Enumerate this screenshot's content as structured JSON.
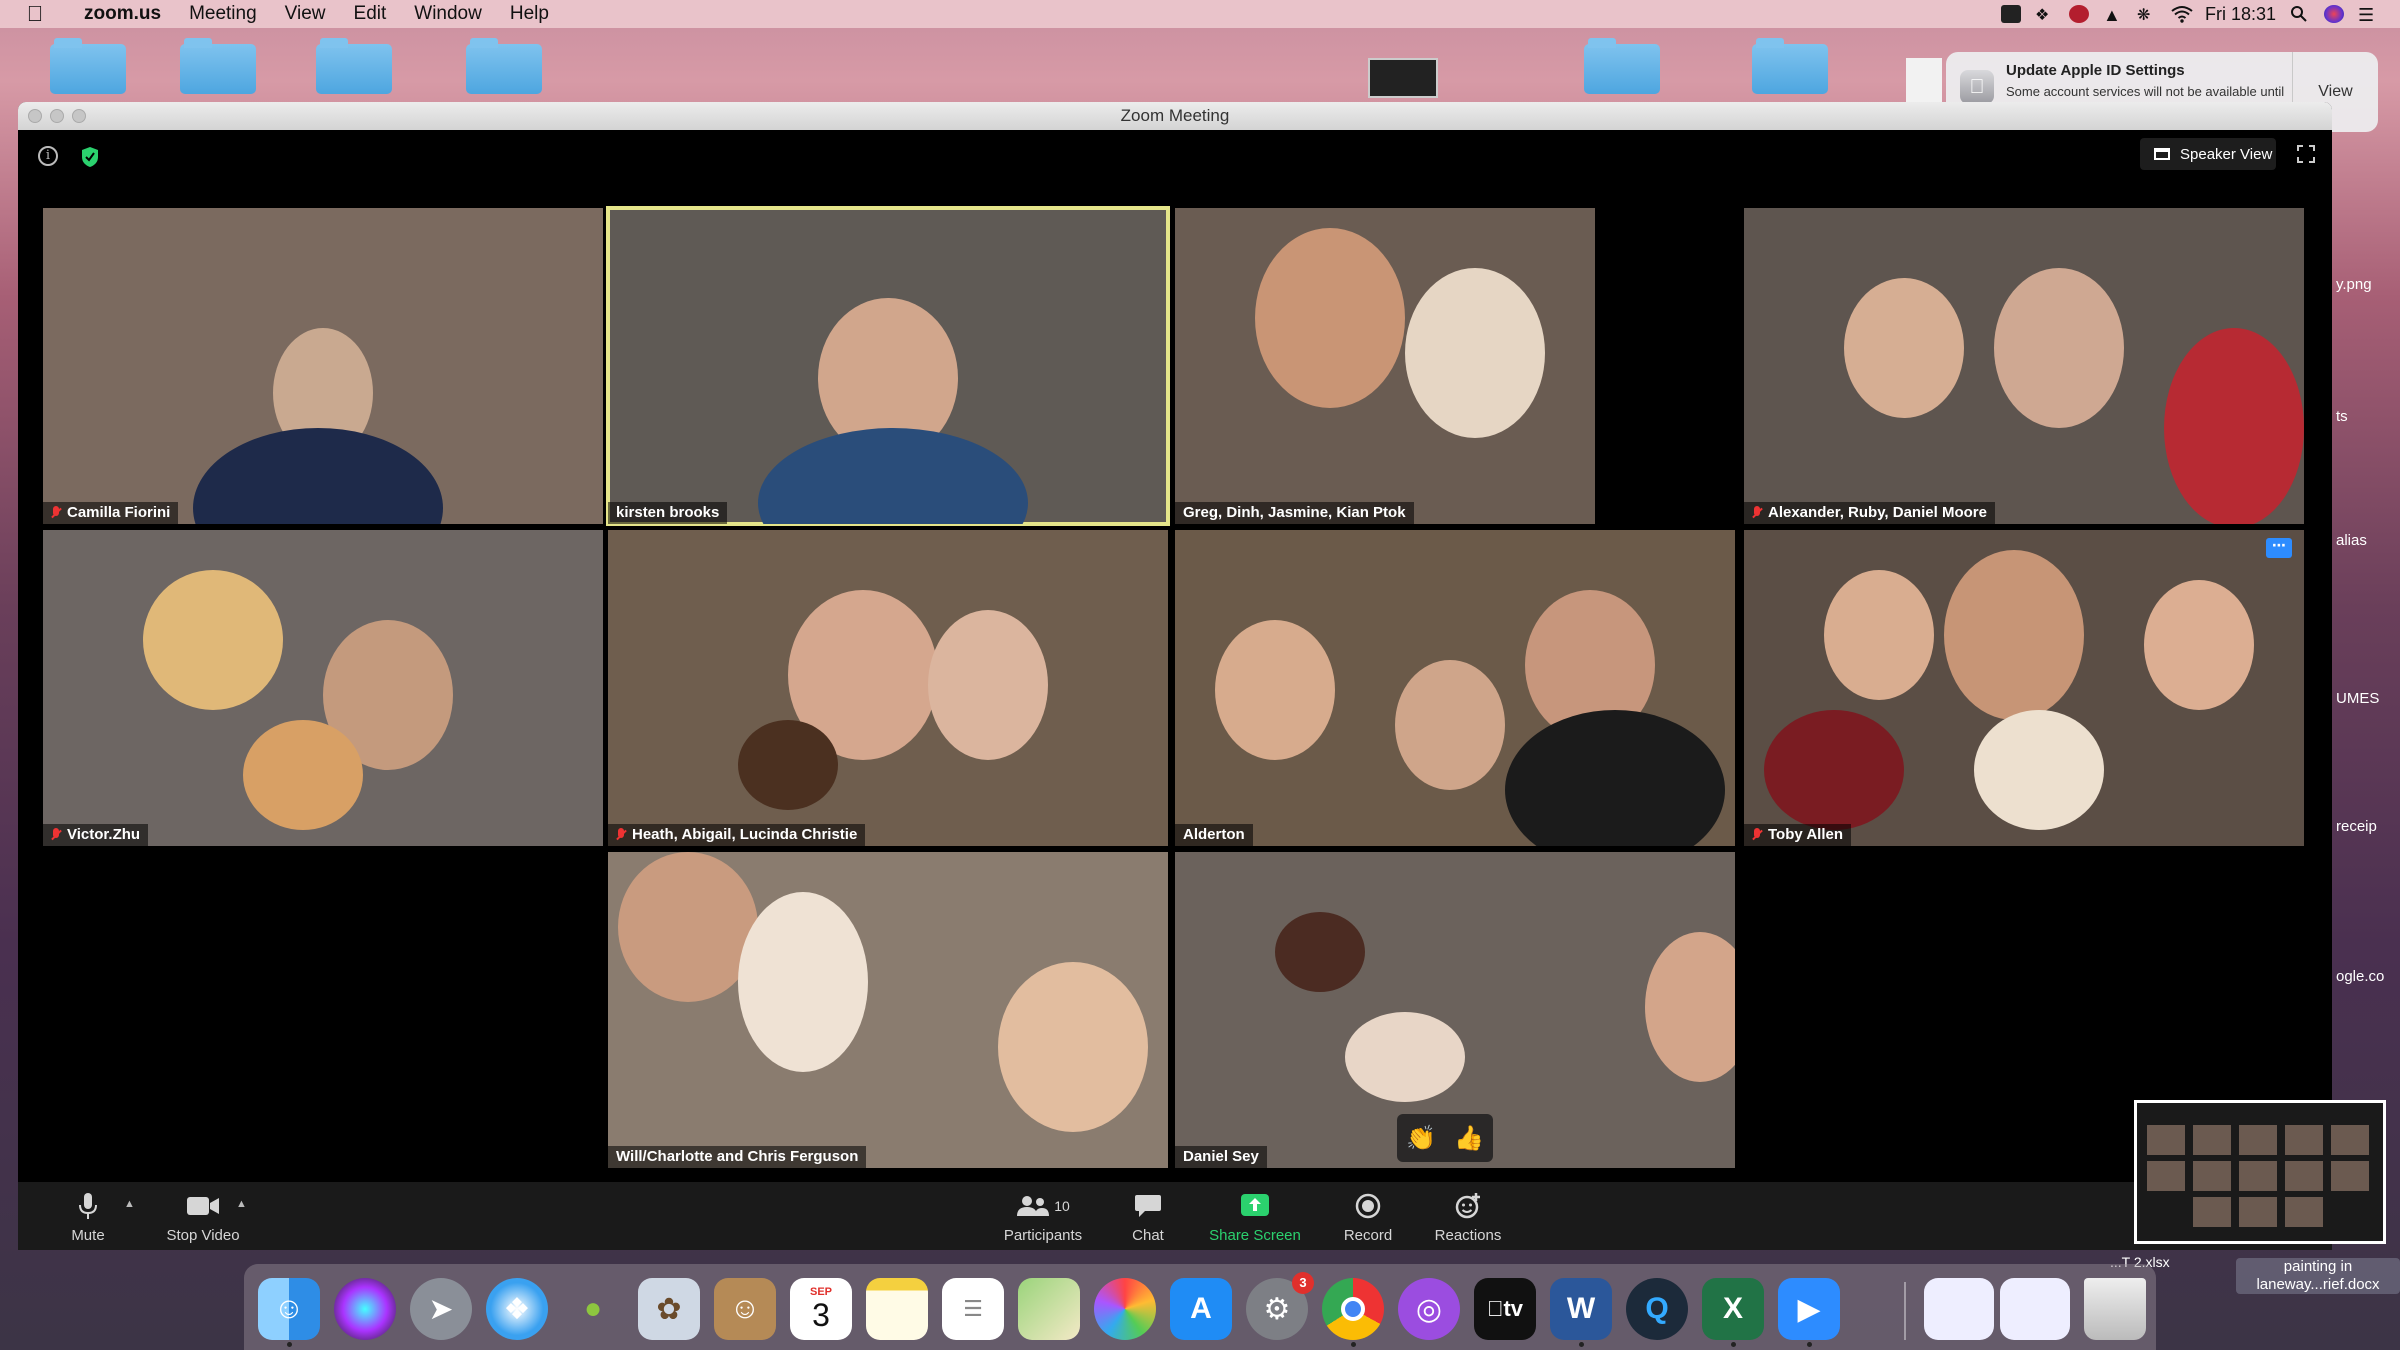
{
  "menubar": {
    "app_name": "zoom.us",
    "menus": [
      "Meeting",
      "View",
      "Edit",
      "Window",
      "Help"
    ],
    "clock": "Fri 18:31"
  },
  "notification": {
    "title": "Update Apple ID Settings",
    "message": "Some account services will not be available until you sign in again.",
    "action": "View"
  },
  "window": {
    "title": "Zoom Meeting",
    "speaker_view_label": "Speaker View"
  },
  "participants_tiles": [
    {
      "name": "Camilla Fiorini",
      "muted": true,
      "active": false,
      "bg": "#7b6a5f"
    },
    {
      "name": "kirsten brooks",
      "muted": false,
      "active": true,
      "bg": "#5f5a55"
    },
    {
      "name": "Greg, Dinh, Jasmine, Kian Ptok",
      "muted": false,
      "active": false,
      "bg": "#6a5c52"
    },
    {
      "name": "Alexander, Ruby, Daniel Moore",
      "muted": true,
      "active": false,
      "bg": "#5e554f"
    },
    {
      "name": "Victor.Zhu",
      "muted": true,
      "active": false,
      "bg": "#6d6663"
    },
    {
      "name": "Heath, Abigail, Lucinda Christie",
      "muted": true,
      "active": false,
      "bg": "#6f5e4e"
    },
    {
      "name": "Alderton",
      "muted": false,
      "active": false,
      "bg": "#6b5a49"
    },
    {
      "name": "Toby Allen",
      "muted": true,
      "active": false,
      "bg": "#5b4e45"
    },
    {
      "name": "Will/Charlotte and Chris Ferguson",
      "muted": false,
      "active": false,
      "bg": "#8a7c6f"
    },
    {
      "name": "Daniel Sey",
      "muted": false,
      "active": false,
      "bg": "#6b625c"
    }
  ],
  "reactions_popup": [
    "👏",
    "👍"
  ],
  "toolbar": {
    "mute": "Mute",
    "stop_video": "Stop Video",
    "participants": "Participants",
    "participants_count": "10",
    "chat": "Chat",
    "share_screen": "Share Screen",
    "record": "Record",
    "reactions": "Reactions"
  },
  "dock": {
    "calendar_month": "SEP",
    "calendar_day": "3",
    "system_prefs_badge": "3",
    "tv_label": "tv"
  },
  "desktop_labels": {
    "png": "y.png",
    "ts": "ts",
    "alias": "alias",
    "umes": "UMES",
    "receipt": "receip",
    "google": "ogle.co",
    "xlsx": "...T 2.xlsx",
    "docx_line1": "painting in",
    "docx_line2": "laneway...rief.docx"
  },
  "colors": {
    "active_speaker_border": "#e5e58a",
    "share_screen_green": "#2bd16e",
    "muted_red": "#e33333",
    "zoom_blue": "#2d8cff"
  }
}
